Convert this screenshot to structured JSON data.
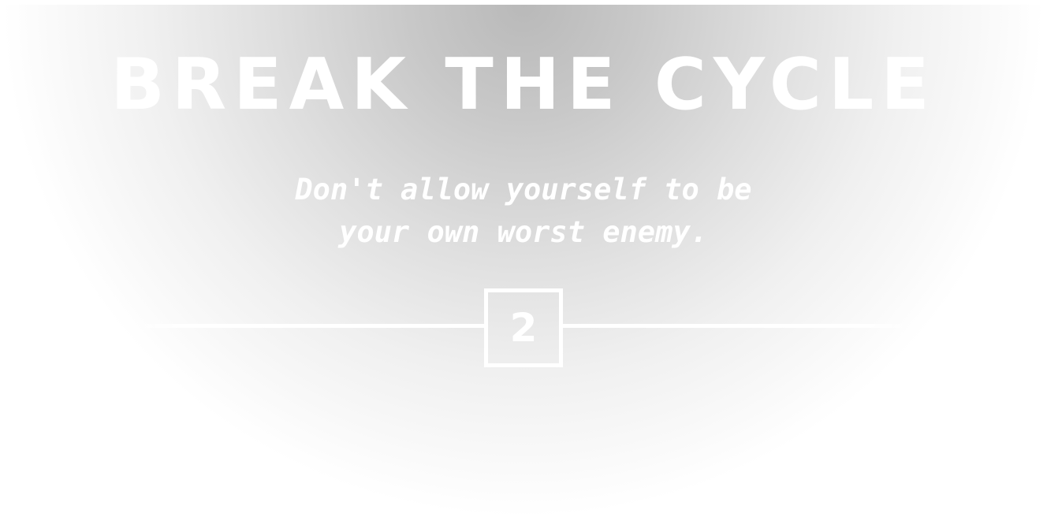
{
  "hero": {
    "title": "BREAK THE CYCLE",
    "subtitle_lines": [
      "Don't allow yourself to be",
      "your own worst enemy."
    ]
  },
  "pager": {
    "current_slide": "2"
  },
  "colors": {
    "text": "#ffffff",
    "vignette_center": "#b9b9b9",
    "background": "#ffffff"
  }
}
